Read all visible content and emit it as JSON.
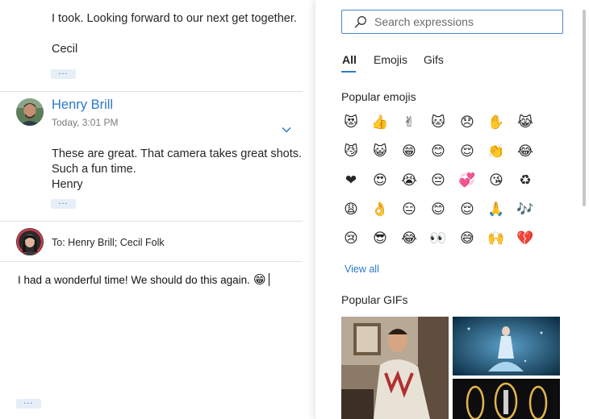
{
  "thread": {
    "prev_message": {
      "line1": "I took. Looking forward to our next get together.",
      "signature": "Cecil",
      "more": "..."
    },
    "message": {
      "sender": "Henry Brill",
      "time": "Today, 3:01 PM",
      "line1": "These are great. That camera takes great shots.",
      "line2": "Such a fun time.",
      "signature": "Henry",
      "more": "..."
    },
    "compose": {
      "to_label": "To:",
      "recipients": "Henry Brill; Cecil Folk",
      "body": "I had a wonderful time!  We should do this again.",
      "inline_emoji": "😁",
      "more": "..."
    }
  },
  "expressions": {
    "search_placeholder": "Search expressions",
    "tabs": [
      {
        "label": "All",
        "active": true
      },
      {
        "label": "Emojis",
        "active": false
      },
      {
        "label": "Gifs",
        "active": false
      }
    ],
    "popular_emojis_heading": "Popular emojis",
    "emojis": [
      [
        "😻",
        "👍",
        "✌",
        "🐱",
        "😞",
        "✋",
        "😹"
      ],
      [
        "😼",
        "😺",
        "😁",
        "😊",
        "😌",
        "👏",
        "😂"
      ],
      [
        "❤",
        "😍",
        "😭",
        "😔",
        "💞",
        "😘",
        "♻"
      ],
      [
        "😩",
        "👌",
        "😑",
        "😊",
        "😌",
        "🙏",
        "🎶"
      ],
      [
        "😢",
        "😎",
        "😂",
        "👀",
        "😅",
        "🙌",
        "💔"
      ]
    ],
    "view_all": "View all",
    "popular_gifs_heading": "Popular GIFs"
  },
  "colors": {
    "accent": "#2b79c9",
    "search_border": "#4a86cc",
    "divider": "#e3e3e3"
  }
}
